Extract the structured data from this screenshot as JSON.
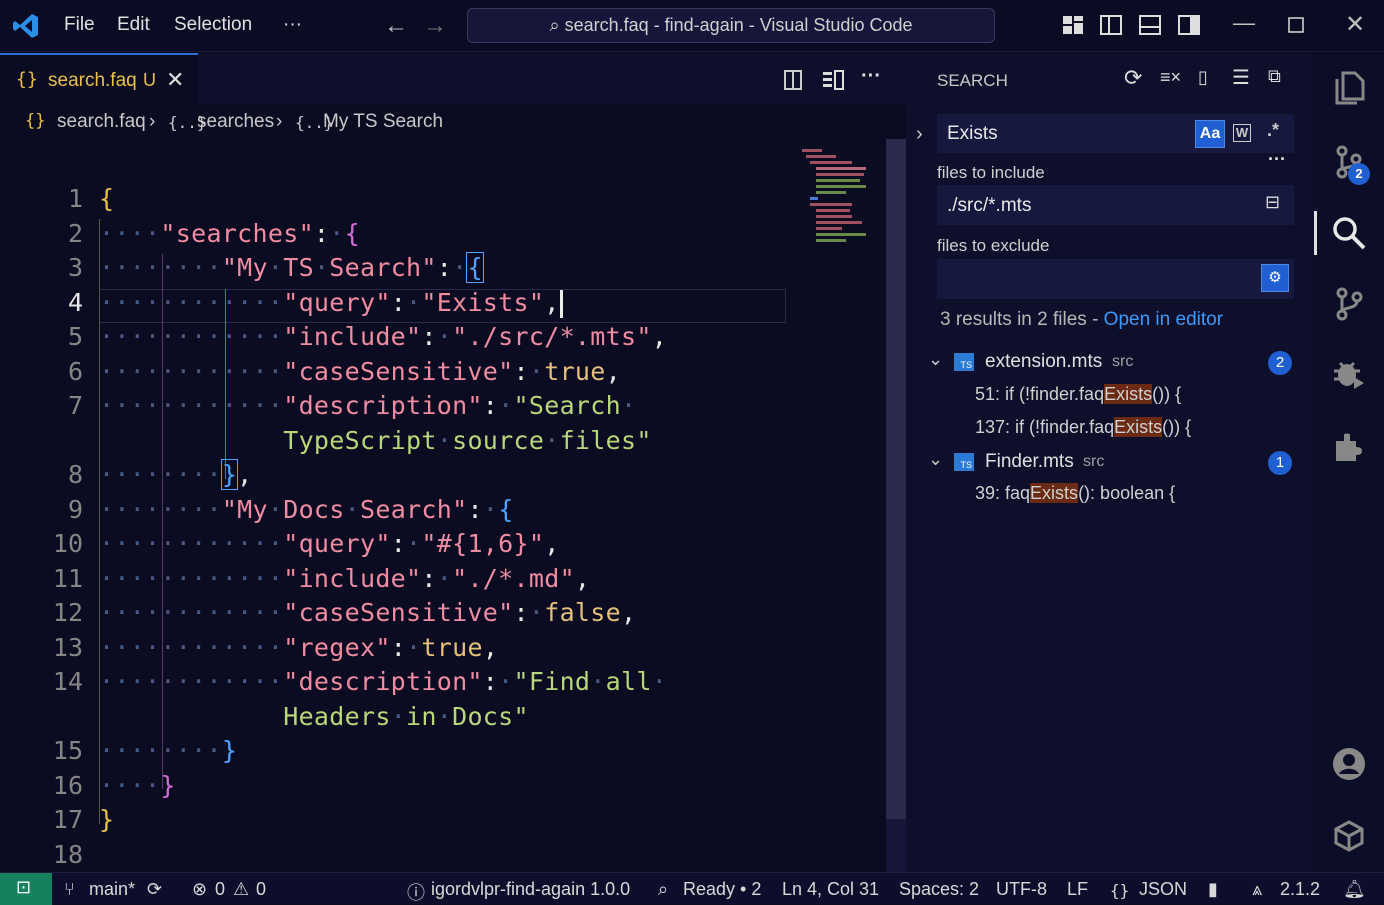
{
  "titlebar": {
    "menu": [
      "File",
      "Edit",
      "Selection",
      "···"
    ],
    "command_center": "search.faq - find-again - Visual Studio Code"
  },
  "tab": {
    "label": "search.faq",
    "status": "U",
    "icon": "{}"
  },
  "breadcrumb": {
    "file": "search.faq",
    "seg1": "searches",
    "seg2": "My TS Search"
  },
  "editor": {
    "line_numbers": [
      "1",
      "2",
      "3",
      "4",
      "5",
      "6",
      "7",
      "",
      "8",
      "9",
      "10",
      "11",
      "12",
      "13",
      "14",
      "",
      "15",
      "16",
      "17",
      "18"
    ]
  },
  "search_panel": {
    "title": "SEARCH",
    "query": "Exists",
    "case_label": "Aa",
    "word_label": "W",
    "regex_label": ".*",
    "include_label": "files to include",
    "include_value": "./src/*.mts",
    "exclude_label": "files to exclude",
    "exclude_value": "",
    "summary": "3 results in 2 files - ",
    "open_in_editor": "Open in editor",
    "files": [
      {
        "name": "extension.mts",
        "dir": "src",
        "count": "2",
        "matches": [
          {
            "pre": "51: if (!finder.faq",
            "hit": "Exists",
            "post": "()) {"
          },
          {
            "pre": "137: if (!finder.faq",
            "hit": "Exists",
            "post": "()) {"
          }
        ]
      },
      {
        "name": "Finder.mts",
        "dir": "src",
        "count": "1",
        "matches": [
          {
            "pre": "39: faq",
            "hit": "Exists",
            "post": "(): boolean {"
          }
        ]
      }
    ]
  },
  "activity_badge": "2",
  "statusbar": {
    "branch": "main*",
    "errors": "0",
    "warnings": "0",
    "extension": "igordvlpr-find-again 1.0.0",
    "search_status": "Ready • 2",
    "position": "Ln 4, Col 31",
    "spaces": "Spaces: 2",
    "encoding": "UTF-8",
    "eol": "LF",
    "language": "JSON",
    "version": "2.1.2"
  },
  "colors": {
    "accent": "#2a6fd6",
    "string": "#f08ca2",
    "value": "#b8d67a",
    "keyword": "#e5c07b",
    "brace1": "#e8c04a",
    "brace2": "#d16fd6",
    "brace3": "#4ea3ff",
    "remote": "#16825d"
  }
}
